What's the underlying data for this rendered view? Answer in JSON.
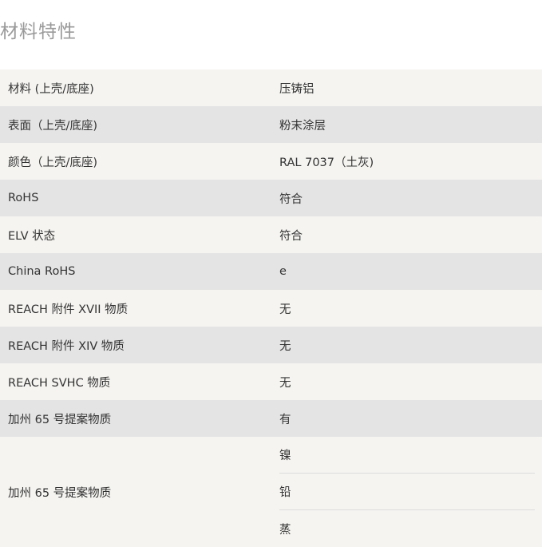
{
  "section": {
    "title": "材料特性"
  },
  "rows": [
    {
      "label": "材料 (上壳/底座)",
      "value": "压铸铝"
    },
    {
      "label": "表面（上壳/底座)",
      "value": "粉末涂层"
    },
    {
      "label": "颜色（上壳/底座)",
      "value": "RAL 7037（土灰)"
    },
    {
      "label": "RoHS",
      "value": "符合"
    },
    {
      "label": "ELV 状态",
      "value": "符合"
    },
    {
      "label": "China RoHS",
      "value": "e"
    },
    {
      "label": "REACH 附件 XVII 物质",
      "value": "无"
    },
    {
      "label": "REACH 附件 XIV 物质",
      "value": "无"
    },
    {
      "label": "REACH SVHC 物质",
      "value": "无"
    },
    {
      "label": "加州 65 号提案物质",
      "value": "有"
    }
  ],
  "multi_row": {
    "label": "加州 65 号提案物质",
    "values": [
      "镍",
      "铅",
      "蒸"
    ]
  },
  "colors": {
    "row_light": "#f5f4f1",
    "row_dark": "#e4e4e4",
    "title": "#9a9a9a",
    "text": "#333333"
  }
}
